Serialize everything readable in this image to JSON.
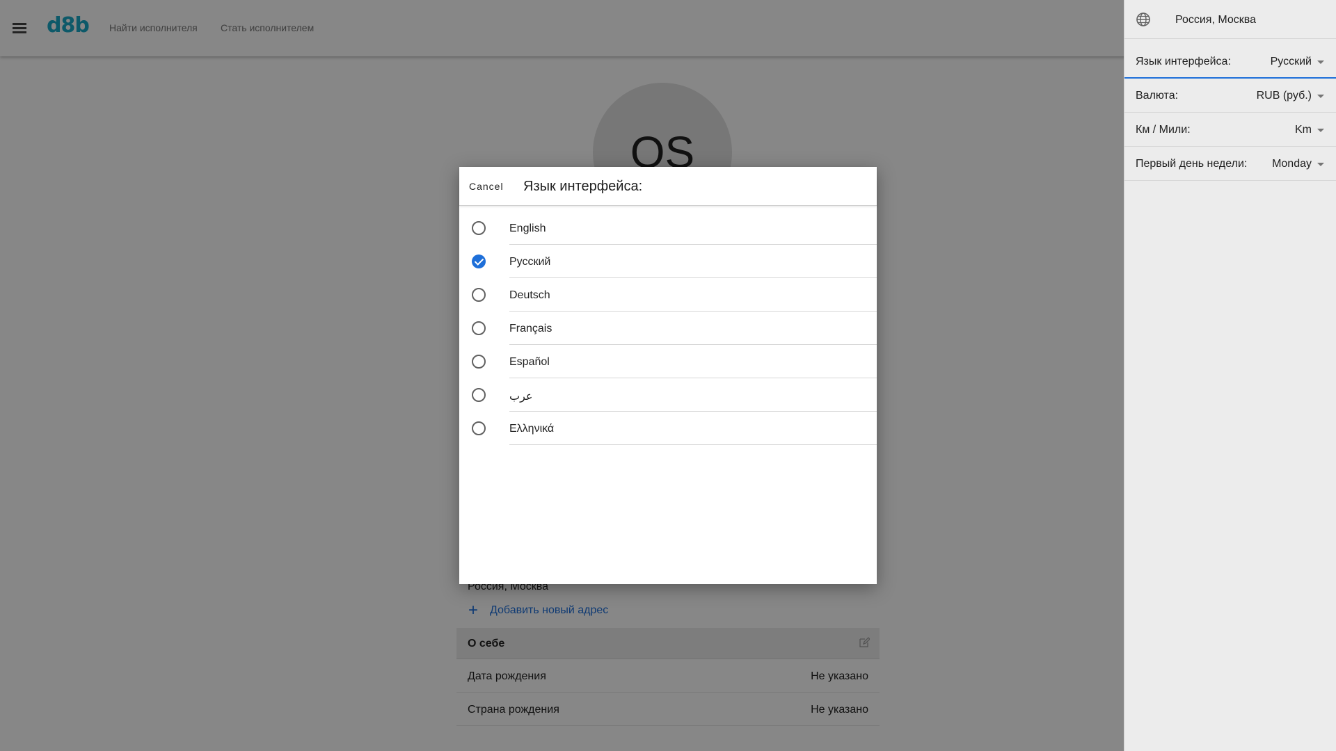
{
  "header": {
    "logo": "d8b",
    "nav": {
      "find": "Найти исполнителя",
      "become": "Стать исполнителем"
    }
  },
  "profile": {
    "initials": "OS",
    "address": "Россия, Москва",
    "add_address": "Добавить новый адрес",
    "about_title": "О себе",
    "rows": [
      {
        "label": "Дата рождения",
        "value": "Не указано"
      },
      {
        "label": "Страна рождения",
        "value": "Не указано"
      }
    ]
  },
  "panel": {
    "location": "Россия, Москва",
    "settings": [
      {
        "label": "Язык интерфейса:",
        "value": "Русский"
      },
      {
        "label": "Валюта:",
        "value": "RUB (руб.)"
      },
      {
        "label": "Км / Мили:",
        "value": "Km"
      },
      {
        "label": "Первый день недели:",
        "value": "Monday"
      }
    ]
  },
  "dialog": {
    "cancel": "Cancel",
    "title": "Язык интерфейса:",
    "options": [
      {
        "label": "English",
        "checked": false
      },
      {
        "label": "Русский",
        "checked": true
      },
      {
        "label": "Deutsch",
        "checked": false
      },
      {
        "label": "Français",
        "checked": false
      },
      {
        "label": "Español",
        "checked": false
      },
      {
        "label": "عرب",
        "checked": false
      },
      {
        "label": "Ελληνικά",
        "checked": false
      }
    ]
  },
  "colors": {
    "brand": "#1aa9c6",
    "accent": "#1e6fd9"
  }
}
